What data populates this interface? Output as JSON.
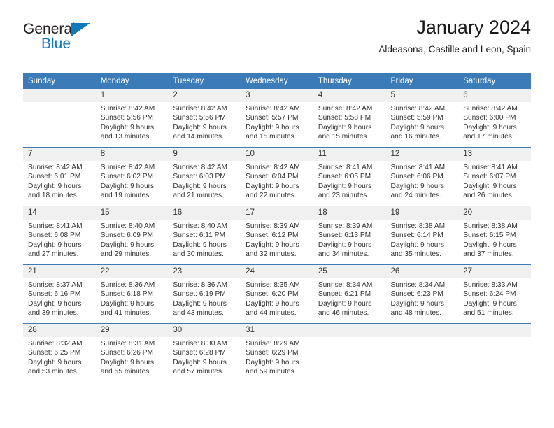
{
  "brand": {
    "name_dark": "General",
    "name_light": "Blue",
    "triangle_color": "#1278be"
  },
  "header": {
    "title": "January 2024",
    "subtitle": "Aldeasona, Castille and Leon, Spain"
  },
  "theme": {
    "header_row_bg": "#3b7cb8",
    "header_row_text": "#ffffff",
    "daynum_bg": "#f0f0f0",
    "grid_line": "#3b7cb8"
  },
  "weekday_headers": [
    "Sunday",
    "Monday",
    "Tuesday",
    "Wednesday",
    "Thursday",
    "Friday",
    "Saturday"
  ],
  "weeks": [
    [
      {
        "day": "",
        "sunrise": "",
        "sunset": "",
        "daylight_1": "",
        "daylight_2": ""
      },
      {
        "day": "1",
        "sunrise": "Sunrise: 8:42 AM",
        "sunset": "Sunset: 5:56 PM",
        "daylight_1": "Daylight: 9 hours",
        "daylight_2": "and 13 minutes."
      },
      {
        "day": "2",
        "sunrise": "Sunrise: 8:42 AM",
        "sunset": "Sunset: 5:56 PM",
        "daylight_1": "Daylight: 9 hours",
        "daylight_2": "and 14 minutes."
      },
      {
        "day": "3",
        "sunrise": "Sunrise: 8:42 AM",
        "sunset": "Sunset: 5:57 PM",
        "daylight_1": "Daylight: 9 hours",
        "daylight_2": "and 15 minutes."
      },
      {
        "day": "4",
        "sunrise": "Sunrise: 8:42 AM",
        "sunset": "Sunset: 5:58 PM",
        "daylight_1": "Daylight: 9 hours",
        "daylight_2": "and 15 minutes."
      },
      {
        "day": "5",
        "sunrise": "Sunrise: 8:42 AM",
        "sunset": "Sunset: 5:59 PM",
        "daylight_1": "Daylight: 9 hours",
        "daylight_2": "and 16 minutes."
      },
      {
        "day": "6",
        "sunrise": "Sunrise: 8:42 AM",
        "sunset": "Sunset: 6:00 PM",
        "daylight_1": "Daylight: 9 hours",
        "daylight_2": "and 17 minutes."
      }
    ],
    [
      {
        "day": "7",
        "sunrise": "Sunrise: 8:42 AM",
        "sunset": "Sunset: 6:01 PM",
        "daylight_1": "Daylight: 9 hours",
        "daylight_2": "and 18 minutes."
      },
      {
        "day": "8",
        "sunrise": "Sunrise: 8:42 AM",
        "sunset": "Sunset: 6:02 PM",
        "daylight_1": "Daylight: 9 hours",
        "daylight_2": "and 19 minutes."
      },
      {
        "day": "9",
        "sunrise": "Sunrise: 8:42 AM",
        "sunset": "Sunset: 6:03 PM",
        "daylight_1": "Daylight: 9 hours",
        "daylight_2": "and 21 minutes."
      },
      {
        "day": "10",
        "sunrise": "Sunrise: 8:42 AM",
        "sunset": "Sunset: 6:04 PM",
        "daylight_1": "Daylight: 9 hours",
        "daylight_2": "and 22 minutes."
      },
      {
        "day": "11",
        "sunrise": "Sunrise: 8:41 AM",
        "sunset": "Sunset: 6:05 PM",
        "daylight_1": "Daylight: 9 hours",
        "daylight_2": "and 23 minutes."
      },
      {
        "day": "12",
        "sunrise": "Sunrise: 8:41 AM",
        "sunset": "Sunset: 6:06 PM",
        "daylight_1": "Daylight: 9 hours",
        "daylight_2": "and 24 minutes."
      },
      {
        "day": "13",
        "sunrise": "Sunrise: 8:41 AM",
        "sunset": "Sunset: 6:07 PM",
        "daylight_1": "Daylight: 9 hours",
        "daylight_2": "and 26 minutes."
      }
    ],
    [
      {
        "day": "14",
        "sunrise": "Sunrise: 8:41 AM",
        "sunset": "Sunset: 6:08 PM",
        "daylight_1": "Daylight: 9 hours",
        "daylight_2": "and 27 minutes."
      },
      {
        "day": "15",
        "sunrise": "Sunrise: 8:40 AM",
        "sunset": "Sunset: 6:09 PM",
        "daylight_1": "Daylight: 9 hours",
        "daylight_2": "and 29 minutes."
      },
      {
        "day": "16",
        "sunrise": "Sunrise: 8:40 AM",
        "sunset": "Sunset: 6:11 PM",
        "daylight_1": "Daylight: 9 hours",
        "daylight_2": "and 30 minutes."
      },
      {
        "day": "17",
        "sunrise": "Sunrise: 8:39 AM",
        "sunset": "Sunset: 6:12 PM",
        "daylight_1": "Daylight: 9 hours",
        "daylight_2": "and 32 minutes."
      },
      {
        "day": "18",
        "sunrise": "Sunrise: 8:39 AM",
        "sunset": "Sunset: 6:13 PM",
        "daylight_1": "Daylight: 9 hours",
        "daylight_2": "and 34 minutes."
      },
      {
        "day": "19",
        "sunrise": "Sunrise: 8:38 AM",
        "sunset": "Sunset: 6:14 PM",
        "daylight_1": "Daylight: 9 hours",
        "daylight_2": "and 35 minutes."
      },
      {
        "day": "20",
        "sunrise": "Sunrise: 8:38 AM",
        "sunset": "Sunset: 6:15 PM",
        "daylight_1": "Daylight: 9 hours",
        "daylight_2": "and 37 minutes."
      }
    ],
    [
      {
        "day": "21",
        "sunrise": "Sunrise: 8:37 AM",
        "sunset": "Sunset: 6:16 PM",
        "daylight_1": "Daylight: 9 hours",
        "daylight_2": "and 39 minutes."
      },
      {
        "day": "22",
        "sunrise": "Sunrise: 8:36 AM",
        "sunset": "Sunset: 6:18 PM",
        "daylight_1": "Daylight: 9 hours",
        "daylight_2": "and 41 minutes."
      },
      {
        "day": "23",
        "sunrise": "Sunrise: 8:36 AM",
        "sunset": "Sunset: 6:19 PM",
        "daylight_1": "Daylight: 9 hours",
        "daylight_2": "and 43 minutes."
      },
      {
        "day": "24",
        "sunrise": "Sunrise: 8:35 AM",
        "sunset": "Sunset: 6:20 PM",
        "daylight_1": "Daylight: 9 hours",
        "daylight_2": "and 44 minutes."
      },
      {
        "day": "25",
        "sunrise": "Sunrise: 8:34 AM",
        "sunset": "Sunset: 6:21 PM",
        "daylight_1": "Daylight: 9 hours",
        "daylight_2": "and 46 minutes."
      },
      {
        "day": "26",
        "sunrise": "Sunrise: 8:34 AM",
        "sunset": "Sunset: 6:23 PM",
        "daylight_1": "Daylight: 9 hours",
        "daylight_2": "and 48 minutes."
      },
      {
        "day": "27",
        "sunrise": "Sunrise: 8:33 AM",
        "sunset": "Sunset: 6:24 PM",
        "daylight_1": "Daylight: 9 hours",
        "daylight_2": "and 51 minutes."
      }
    ],
    [
      {
        "day": "28",
        "sunrise": "Sunrise: 8:32 AM",
        "sunset": "Sunset: 6:25 PM",
        "daylight_1": "Daylight: 9 hours",
        "daylight_2": "and 53 minutes."
      },
      {
        "day": "29",
        "sunrise": "Sunrise: 8:31 AM",
        "sunset": "Sunset: 6:26 PM",
        "daylight_1": "Daylight: 9 hours",
        "daylight_2": "and 55 minutes."
      },
      {
        "day": "30",
        "sunrise": "Sunrise: 8:30 AM",
        "sunset": "Sunset: 6:28 PM",
        "daylight_1": "Daylight: 9 hours",
        "daylight_2": "and 57 minutes."
      },
      {
        "day": "31",
        "sunrise": "Sunrise: 8:29 AM",
        "sunset": "Sunset: 6:29 PM",
        "daylight_1": "Daylight: 9 hours",
        "daylight_2": "and 59 minutes."
      },
      {
        "day": "",
        "sunrise": "",
        "sunset": "",
        "daylight_1": "",
        "daylight_2": ""
      },
      {
        "day": "",
        "sunrise": "",
        "sunset": "",
        "daylight_1": "",
        "daylight_2": ""
      },
      {
        "day": "",
        "sunrise": "",
        "sunset": "",
        "daylight_1": "",
        "daylight_2": ""
      }
    ]
  ]
}
